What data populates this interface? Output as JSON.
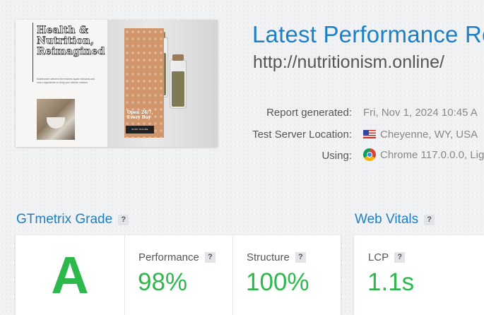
{
  "thumbnail": {
    "headline": "Health & Nutrition, Reimagined",
    "subtext": "Nutritionism delivers the freshest super infusions and micro-ingredients to bring your kitchen wisdom.",
    "promo": "Open 24/7, Every Day",
    "button_label": "SHOP ONLINE"
  },
  "report": {
    "title": "Latest Performance Re",
    "url": "http://nutritionism.online/",
    "meta": [
      {
        "label": "Report generated:",
        "value": "Fri, Nov 1, 2024 10:45 A",
        "icon": ""
      },
      {
        "label": "Test Server Location:",
        "value": "Cheyenne, WY, USA",
        "icon": "us-flag-icon"
      },
      {
        "label": "Using:",
        "value": "Chrome 117.0.0.0, Lig",
        "icon": "chrome-icon"
      }
    ]
  },
  "gtmetrix": {
    "title": "GTmetrix Grade",
    "help": "?",
    "grade": "A",
    "performance_label": "Performance",
    "performance_value": "98%",
    "structure_label": "Structure",
    "structure_value": "100%"
  },
  "web_vitals": {
    "title": "Web Vitals",
    "help": "?",
    "lcp_label": "LCP",
    "lcp_value": "1.1s"
  },
  "colors": {
    "accent": "#1f7fc4",
    "good": "#2db84b"
  }
}
